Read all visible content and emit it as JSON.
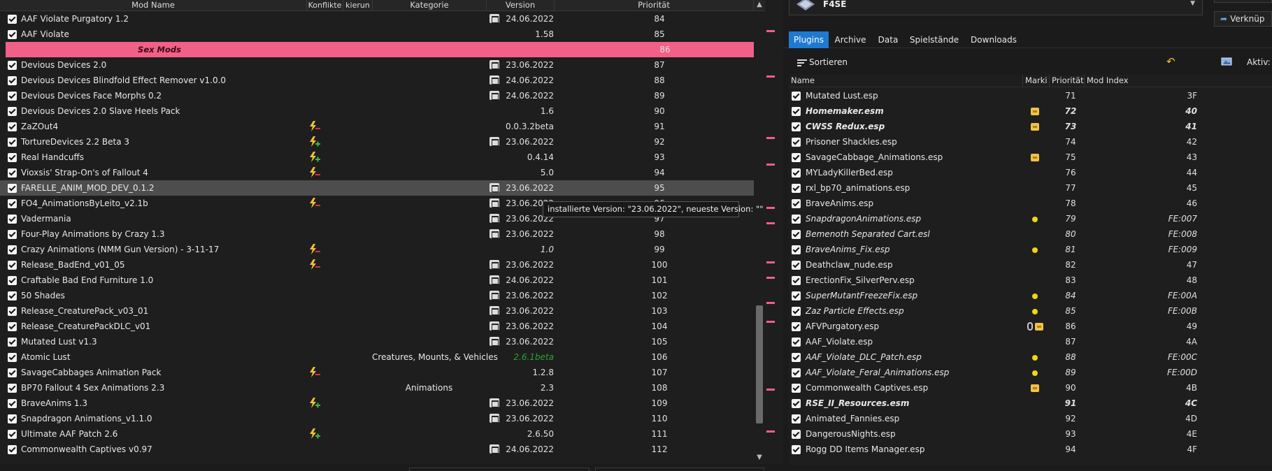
{
  "modlist": {
    "headers": {
      "name": "Mod Name",
      "conflicts": "Konflikte",
      "flags": "kierun",
      "category": "Kategorie",
      "version": "Version",
      "priority": "Priorität"
    },
    "rows": [
      {
        "name": "AAF Violate Purgatory 1.2",
        "update": true,
        "version": "24.06.2022",
        "priority": "84"
      },
      {
        "name": "AAF Violate",
        "version": "1.58",
        "priority": "85"
      },
      {
        "separator": true,
        "name": "Sex Mods",
        "priority": "86"
      },
      {
        "name": "Devious Devices 2.0",
        "update": true,
        "version": "23.06.2022",
        "priority": "87"
      },
      {
        "name": "Devious Devices Blindfold Effect Remover v1.0.0",
        "update": true,
        "version": "24.06.2022",
        "priority": "88"
      },
      {
        "name": "Devious Devices Face Morphs 0.2",
        "update": true,
        "version": "24.06.2022",
        "priority": "89"
      },
      {
        "name": "Devious Devices 2.0 Slave Heels Pack",
        "version": "1.6",
        "priority": "90"
      },
      {
        "name": "ZaZOut4",
        "flag": "red",
        "version": "0.0.3.2beta",
        "priority": "91"
      },
      {
        "name": "TortureDevices 2.2 Beta 3",
        "flag": "green",
        "update": true,
        "version": "23.06.2022",
        "priority": "92"
      },
      {
        "name": "Real Handcuffs",
        "flag": "green",
        "version": "0.4.14",
        "priority": "93"
      },
      {
        "name": "Vioxsis' Strap-On's of Fallout 4",
        "flag": "red",
        "version": "5.0",
        "priority": "94"
      },
      {
        "name": "FARELLE_ANIM_MOD_DEV_0.1.2",
        "selected": true,
        "update": true,
        "version": "23.06.2022",
        "priority": "95"
      },
      {
        "name": "FO4_AnimationsByLeito_v2.1b",
        "flag": "red",
        "update": true,
        "version": "23.06.2022",
        "priority": "96"
      },
      {
        "name": "Vadermania",
        "update": true,
        "version": "23.06.2022",
        "priority": "97"
      },
      {
        "name": "Four-Play Animations by Crazy 1.3",
        "update": true,
        "version": "23.06.2022",
        "priority": "98"
      },
      {
        "name": "Crazy Animations (NMM Gun Version) - 3-11-17",
        "flag": "red",
        "version": "1.0",
        "version_italic": true,
        "priority": "99"
      },
      {
        "name": "Release_BadEnd_v01_05",
        "flag": "red",
        "update": true,
        "version": "23.06.2022",
        "priority": "100"
      },
      {
        "name": "Craftable Bad End Furniture 1.0",
        "update": true,
        "version": "24.06.2022",
        "priority": "101"
      },
      {
        "name": "50 Shades",
        "update": true,
        "version": "23.06.2022",
        "priority": "102"
      },
      {
        "name": "Release_CreaturePack_v03_01",
        "update": true,
        "version": "23.06.2022",
        "priority": "103"
      },
      {
        "name": "Release_CreaturePackDLC_v01",
        "update": true,
        "version": "23.06.2022",
        "priority": "104"
      },
      {
        "name": "Mutated Lust v1.3",
        "update": true,
        "version": "23.06.2022",
        "priority": "105"
      },
      {
        "name": "Atomic Lust",
        "category": "Creatures, Mounts, & Vehicles",
        "version": "2.6.1beta",
        "version_green": true,
        "priority": "106"
      },
      {
        "name": "SavageCabbages Animation Pack",
        "flag": "red",
        "version": "1.2.8",
        "priority": "107"
      },
      {
        "name": "BP70 Fallout 4 Sex Animations 2.3",
        "category": "Animations",
        "version": "2.3",
        "priority": "108"
      },
      {
        "name": "BraveAnims 1.3",
        "flag": "green",
        "update": true,
        "version": "23.06.2022",
        "priority": "109"
      },
      {
        "name": "Snapdragon Animations_v1.1.0",
        "update": true,
        "version": "23.06.2022",
        "priority": "110"
      },
      {
        "name": "Ultimate AAF Patch 2.6",
        "flag": "green",
        "version": "2.6.50",
        "priority": "111"
      },
      {
        "name": "Commonwealth Captives v0.97",
        "update": true,
        "version": "24.06.2022",
        "priority": "112"
      }
    ],
    "tooltip": "installierte Version: \"23.06.2022\", neueste Version: \"\""
  },
  "right": {
    "executable": "F4SE",
    "shortcut_button": "Verknüp",
    "tabs": [
      "Plugins",
      "Archive",
      "Data",
      "Spielstände",
      "Downloads"
    ],
    "active_tab": "Plugins",
    "sort_button": "Sortieren",
    "active_label": "Aktiv:",
    "headers": {
      "name": "Name",
      "flags": "Marki",
      "priority": "Priorität",
      "mod_index": "Mod Index"
    },
    "plugins": [
      {
        "name": "Mutated Lust.esp",
        "priority": "71",
        "index": "3F"
      },
      {
        "name": "Homemaker.esm",
        "style": "bi",
        "mark": "box",
        "priority": "72",
        "index": "40"
      },
      {
        "name": "CWSS Redux.esp",
        "style": "bi",
        "mark": "box",
        "priority": "73",
        "index": "41"
      },
      {
        "name": "Prisoner Shackles.esp",
        "priority": "74",
        "index": "42"
      },
      {
        "name": "SavageCabbage_Animations.esp",
        "mark": "box",
        "priority": "75",
        "index": "43"
      },
      {
        "name": "MYLadyKillerBed.esp",
        "priority": "76",
        "index": "44"
      },
      {
        "name": "rxl_bp70_animations.esp",
        "priority": "77",
        "index": "45"
      },
      {
        "name": "BraveAnims.esp",
        "priority": "78",
        "index": "46"
      },
      {
        "name": "SnapdragonAnimations.esp",
        "style": "it",
        "mark": "dot",
        "priority": "79",
        "index": "FE:007"
      },
      {
        "name": "Bemenoth Separated Cart.esl",
        "style": "it",
        "priority": "80",
        "index": "FE:008"
      },
      {
        "name": "BraveAnims_Fix.esp",
        "style": "it",
        "mark": "dot",
        "priority": "81",
        "index": "FE:009"
      },
      {
        "name": "Deathclaw_nude.esp",
        "priority": "82",
        "index": "47"
      },
      {
        "name": "ErectionFix_SilverPerv.esp",
        "priority": "83",
        "index": "48"
      },
      {
        "name": "SuperMutantFreezeFix.esp",
        "style": "it",
        "mark": "dot",
        "priority": "84",
        "index": "FE:00A"
      },
      {
        "name": "Zaz Particle Effects.esp",
        "style": "it",
        "mark": "dot",
        "priority": "85",
        "index": "FE:00B"
      },
      {
        "name": "AFVPurgatory.esp",
        "mark": "clipbox",
        "priority": "86",
        "index": "49"
      },
      {
        "name": "AAF_Violate.esp",
        "priority": "87",
        "index": "4A"
      },
      {
        "name": "AAF_Violate_DLC_Patch.esp",
        "style": "it",
        "mark": "dot",
        "priority": "88",
        "index": "FE:00C"
      },
      {
        "name": "AAF_Violate_Feral_Animations.esp",
        "style": "it",
        "mark": "dot",
        "priority": "89",
        "index": "FE:00D"
      },
      {
        "name": "Commonwealth Captives.esp",
        "mark": "box",
        "priority": "90",
        "index": "4B"
      },
      {
        "name": "RSE_II_Resources.esm",
        "style": "bi",
        "priority": "91",
        "index": "4C"
      },
      {
        "name": "Animated_Fannies.esp",
        "priority": "92",
        "index": "4D"
      },
      {
        "name": "DangerousNights.esp",
        "priority": "93",
        "index": "4E"
      },
      {
        "name": "Rogg DD Items Manager.esp",
        "priority": "94",
        "index": "4F"
      }
    ]
  },
  "colors": {
    "accent": "#1e7ad1",
    "separator": "#f26087",
    "selected_row": "#4d4d4d",
    "green_version": "#2da034",
    "mark_dot": "#f0d418"
  }
}
